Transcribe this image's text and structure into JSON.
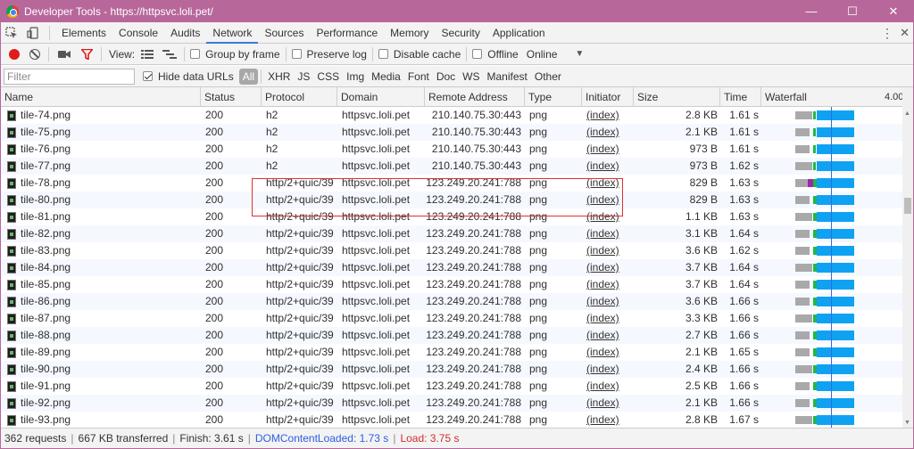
{
  "window": {
    "title": "Developer Tools - https://httpsvc.loli.pet/",
    "minimize": "—",
    "maximize": "☐",
    "close": "✕"
  },
  "tabs": [
    "Elements",
    "Console",
    "Audits",
    "Network",
    "Sources",
    "Performance",
    "Memory",
    "Security",
    "Application"
  ],
  "active_tab": "Network",
  "toolbar": {
    "view_label": "View:",
    "group_by_frame": "Group by frame",
    "preserve_log": "Preserve log",
    "disable_cache": "Disable cache",
    "offline": "Offline",
    "throttle": "Online"
  },
  "filter": {
    "placeholder": "Filter",
    "hide_data_urls": "Hide data URLs",
    "types": [
      "All",
      "XHR",
      "JS",
      "CSS",
      "Img",
      "Media",
      "Font",
      "Doc",
      "WS",
      "Manifest",
      "Other"
    ]
  },
  "columns": {
    "name": "Name",
    "status": "Status",
    "protocol": "Protocol",
    "domain": "Domain",
    "remote": "Remote Address",
    "type": "Type",
    "initiator": "Initiator",
    "size": "Size",
    "time": "Time",
    "waterfall": "Waterfall",
    "waterfall_tick": "4.00"
  },
  "rows": [
    {
      "name": "tile-74.png",
      "status": "200",
      "protocol": "h2",
      "domain": "httpsvc.loli.pet",
      "remote": "210.140.75.30:443",
      "type": "png",
      "initiator": "(index)",
      "size": "2.8 KB",
      "time": "1.61 s"
    },
    {
      "name": "tile-75.png",
      "status": "200",
      "protocol": "h2",
      "domain": "httpsvc.loli.pet",
      "remote": "210.140.75.30:443",
      "type": "png",
      "initiator": "(index)",
      "size": "2.1 KB",
      "time": "1.61 s"
    },
    {
      "name": "tile-76.png",
      "status": "200",
      "protocol": "h2",
      "domain": "httpsvc.loli.pet",
      "remote": "210.140.75.30:443",
      "type": "png",
      "initiator": "(index)",
      "size": "973 B",
      "time": "1.61 s"
    },
    {
      "name": "tile-77.png",
      "status": "200",
      "protocol": "h2",
      "domain": "httpsvc.loli.pet",
      "remote": "210.140.75.30:443",
      "type": "png",
      "initiator": "(index)",
      "size": "973 B",
      "time": "1.62 s"
    },
    {
      "name": "tile-78.png",
      "status": "200",
      "protocol": "http/2+quic/39",
      "domain": "httpsvc.loli.pet",
      "remote": "123.249.20.241:788",
      "type": "png",
      "initiator": "(index)",
      "size": "829 B",
      "time": "1.63 s"
    },
    {
      "name": "tile-80.png",
      "status": "200",
      "protocol": "http/2+quic/39",
      "domain": "httpsvc.loli.pet",
      "remote": "123.249.20.241:788",
      "type": "png",
      "initiator": "(index)",
      "size": "829 B",
      "time": "1.63 s"
    },
    {
      "name": "tile-81.png",
      "status": "200",
      "protocol": "http/2+quic/39",
      "domain": "httpsvc.loli.pet",
      "remote": "123.249.20.241:788",
      "type": "png",
      "initiator": "(index)",
      "size": "1.1 KB",
      "time": "1.63 s"
    },
    {
      "name": "tile-82.png",
      "status": "200",
      "protocol": "http/2+quic/39",
      "domain": "httpsvc.loli.pet",
      "remote": "123.249.20.241:788",
      "type": "png",
      "initiator": "(index)",
      "size": "3.1 KB",
      "time": "1.64 s"
    },
    {
      "name": "tile-83.png",
      "status": "200",
      "protocol": "http/2+quic/39",
      "domain": "httpsvc.loli.pet",
      "remote": "123.249.20.241:788",
      "type": "png",
      "initiator": "(index)",
      "size": "3.6 KB",
      "time": "1.62 s"
    },
    {
      "name": "tile-84.png",
      "status": "200",
      "protocol": "http/2+quic/39",
      "domain": "httpsvc.loli.pet",
      "remote": "123.249.20.241:788",
      "type": "png",
      "initiator": "(index)",
      "size": "3.7 KB",
      "time": "1.64 s"
    },
    {
      "name": "tile-85.png",
      "status": "200",
      "protocol": "http/2+quic/39",
      "domain": "httpsvc.loli.pet",
      "remote": "123.249.20.241:788",
      "type": "png",
      "initiator": "(index)",
      "size": "3.7 KB",
      "time": "1.64 s"
    },
    {
      "name": "tile-86.png",
      "status": "200",
      "protocol": "http/2+quic/39",
      "domain": "httpsvc.loli.pet",
      "remote": "123.249.20.241:788",
      "type": "png",
      "initiator": "(index)",
      "size": "3.6 KB",
      "time": "1.66 s"
    },
    {
      "name": "tile-87.png",
      "status": "200",
      "protocol": "http/2+quic/39",
      "domain": "httpsvc.loli.pet",
      "remote": "123.249.20.241:788",
      "type": "png",
      "initiator": "(index)",
      "size": "3.3 KB",
      "time": "1.66 s"
    },
    {
      "name": "tile-88.png",
      "status": "200",
      "protocol": "http/2+quic/39",
      "domain": "httpsvc.loli.pet",
      "remote": "123.249.20.241:788",
      "type": "png",
      "initiator": "(index)",
      "size": "2.7 KB",
      "time": "1.66 s"
    },
    {
      "name": "tile-89.png",
      "status": "200",
      "protocol": "http/2+quic/39",
      "domain": "httpsvc.loli.pet",
      "remote": "123.249.20.241:788",
      "type": "png",
      "initiator": "(index)",
      "size": "2.1 KB",
      "time": "1.65 s"
    },
    {
      "name": "tile-90.png",
      "status": "200",
      "protocol": "http/2+quic/39",
      "domain": "httpsvc.loli.pet",
      "remote": "123.249.20.241:788",
      "type": "png",
      "initiator": "(index)",
      "size": "2.4 KB",
      "time": "1.66 s"
    },
    {
      "name": "tile-91.png",
      "status": "200",
      "protocol": "http/2+quic/39",
      "domain": "httpsvc.loli.pet",
      "remote": "123.249.20.241:788",
      "type": "png",
      "initiator": "(index)",
      "size": "2.5 KB",
      "time": "1.66 s"
    },
    {
      "name": "tile-92.png",
      "status": "200",
      "protocol": "http/2+quic/39",
      "domain": "httpsvc.loli.pet",
      "remote": "123.249.20.241:788",
      "type": "png",
      "initiator": "(index)",
      "size": "2.1 KB",
      "time": "1.66 s"
    },
    {
      "name": "tile-93.png",
      "status": "200",
      "protocol": "http/2+quic/39",
      "domain": "httpsvc.loli.pet",
      "remote": "123.249.20.241:788",
      "type": "png",
      "initiator": "(index)",
      "size": "2.8 KB",
      "time": "1.67 s"
    }
  ],
  "status": {
    "requests": "362 requests",
    "transferred": "667 KB transferred",
    "finish": "Finish: 3.61 s",
    "dcl": "DOMContentLoaded: 1.73 s",
    "load": "Load: 3.75 s"
  },
  "colors": {
    "titlebar": "#b8679b",
    "record": "#e01b1b",
    "filter_active": "#e01b1b",
    "dcl_text": "#2c5ee3",
    "load_text": "#d12e2e",
    "wf_blue": "#0fa2f2",
    "wf_green": "#1db84a",
    "highlight": "#e03030"
  }
}
